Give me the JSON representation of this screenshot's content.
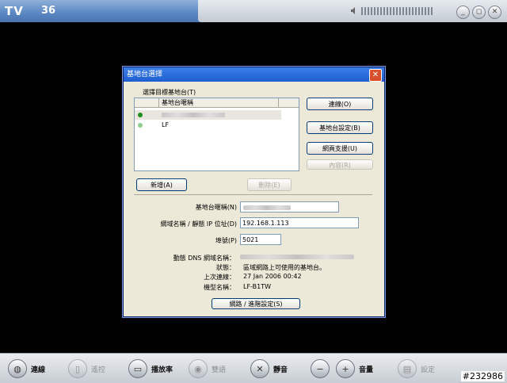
{
  "app": {
    "logo": "TV",
    "channel": "36",
    "volume_icon": "speaker-icon",
    "controls": [
      "_",
      "◻",
      "✕"
    ]
  },
  "dialog": {
    "title": "基地台選擇",
    "select_label": "選擇目標基地台(T)",
    "column_header": "基地台暱稱",
    "rows": [
      {
        "name": "",
        "status_color": "#1a8f1a",
        "blurred": true
      },
      {
        "name": "LF",
        "status_color": "#8fce8f",
        "blurred": false
      }
    ],
    "buttons": {
      "connect": "連線(O)",
      "settings": "基地台設定(B)",
      "web_support": "網頁支援(U)",
      "content": "內容(R)",
      "add": "新增(A)",
      "delete": "刪除(E)",
      "advanced": "網路 / 進階設定(S)"
    },
    "fields": {
      "nickname_label": "基地台暱稱(N)",
      "domain_label": "網域名稱 / 靜態 IP 位址(D)",
      "domain_value": "192.168.1.113",
      "port_label": "埠號(P)",
      "port_value": "5021",
      "ddns_label": "動態 DNS 網域名稱：",
      "status_label": "狀態：",
      "status_value": "區域網路上可使用的基地台。",
      "last_label": "上次連線：",
      "last_value": "27 Jan 2006 00:42",
      "model_label": "機型名稱：",
      "model_value": "LF-B1TW"
    }
  },
  "bottombar": {
    "items": [
      {
        "label": "連線",
        "icon": "globe-icon",
        "enabled": true
      },
      {
        "label": "遙控",
        "icon": "remote-icon",
        "enabled": false
      },
      {
        "label": "播放率",
        "icon": "playrate-icon",
        "enabled": true
      },
      {
        "label": "雙語",
        "icon": "bilingual-icon",
        "enabled": false
      },
      {
        "label": "靜音",
        "icon": "mute-icon",
        "enabled": true
      },
      {
        "label": "音量",
        "icon": "volume-icon",
        "enabled": true
      },
      {
        "label": "設定",
        "icon": "settings-icon",
        "enabled": false
      }
    ],
    "tag": "#232986"
  }
}
